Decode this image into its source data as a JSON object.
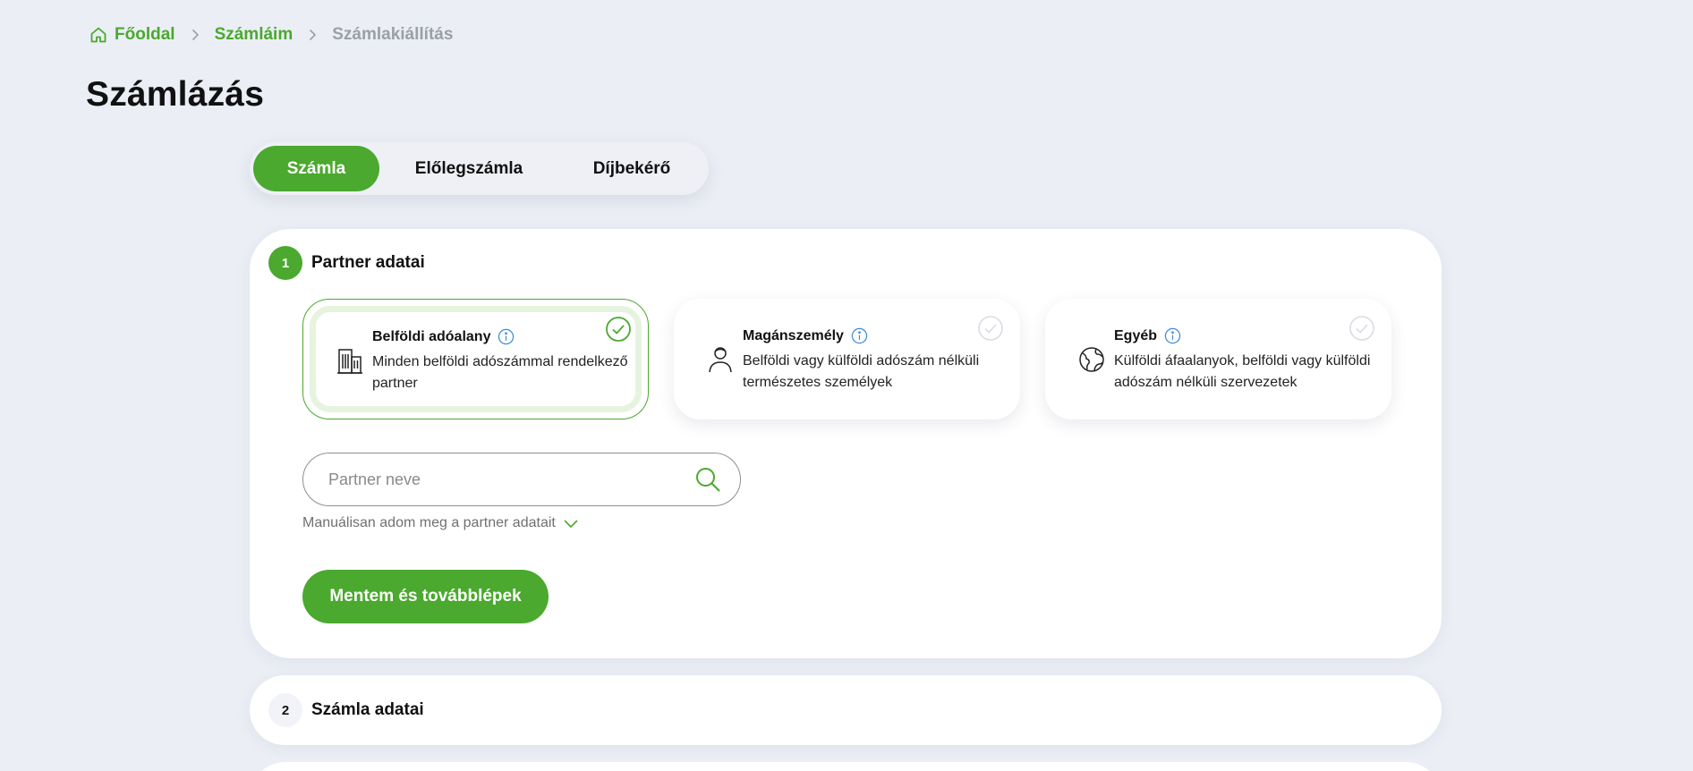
{
  "breadcrumb": {
    "home": "Főoldal",
    "invoices": "Számláim",
    "current": "Számlakiállítás"
  },
  "page_title": "Számlázás",
  "tabs": [
    {
      "label": "Számla",
      "active": true
    },
    {
      "label": "Előlegszámla",
      "active": false
    },
    {
      "label": "Díjbekérő",
      "active": false
    }
  ],
  "step1": {
    "number": "1",
    "title": "Partner adatai",
    "partner_types": [
      {
        "title": "Belföldi adóalany",
        "description": "Minden belföldi adószámmal rendelkező partner",
        "icon": "building-icon",
        "selected": true
      },
      {
        "title": "Magánszemély",
        "description": "Belföldi vagy külföldi adószám nélküli természetes személyek",
        "icon": "person-icon",
        "selected": false
      },
      {
        "title": "Egyéb",
        "description": "Külföldi áfaalanyok, belföldi vagy külföldi adószám nélküli szervezetek",
        "icon": "globe-icon",
        "selected": false
      }
    ],
    "search_placeholder": "Partner neve",
    "search_value": "",
    "manual_label": "Manuálisan adom meg a partner adatait",
    "submit_label": "Mentem és továbblépek"
  },
  "step2": {
    "number": "2",
    "title": "Számla adatai"
  },
  "colors": {
    "accent": "#4aa92e",
    "background": "#ebeef5",
    "info": "#3b8bd9"
  }
}
